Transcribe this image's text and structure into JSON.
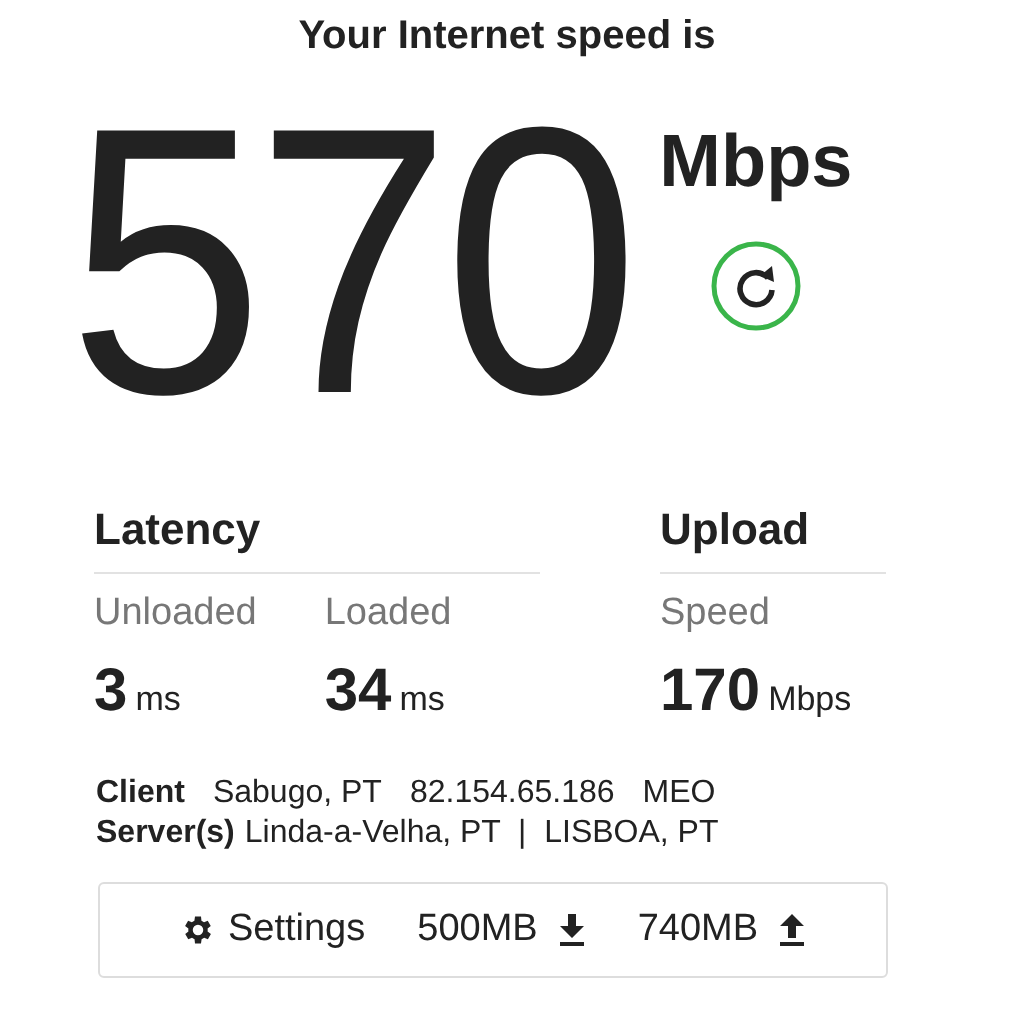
{
  "heading": "Your Internet speed is",
  "speed": {
    "value": "570",
    "unit": "Mbps"
  },
  "groups": [
    {
      "title": "Latency",
      "metrics": [
        {
          "label": "Unloaded",
          "value": "3",
          "unit": "ms"
        },
        {
          "label": "Loaded",
          "value": "34",
          "unit": "ms"
        }
      ]
    },
    {
      "title": "Upload",
      "metrics": [
        {
          "label": "Speed",
          "value": "170",
          "unit": "Mbps"
        }
      ]
    }
  ],
  "info": [
    {
      "label": "Client",
      "parts": [
        "Sabugo, PT",
        "82.154.65.186",
        "MEO"
      ]
    },
    {
      "label": "Server(s)",
      "parts": [
        "Linda-a-Velha, PT  |  LISBOA, PT"
      ]
    }
  ],
  "settings": {
    "label": "Settings",
    "download": "500MB",
    "upload": "740MB"
  }
}
